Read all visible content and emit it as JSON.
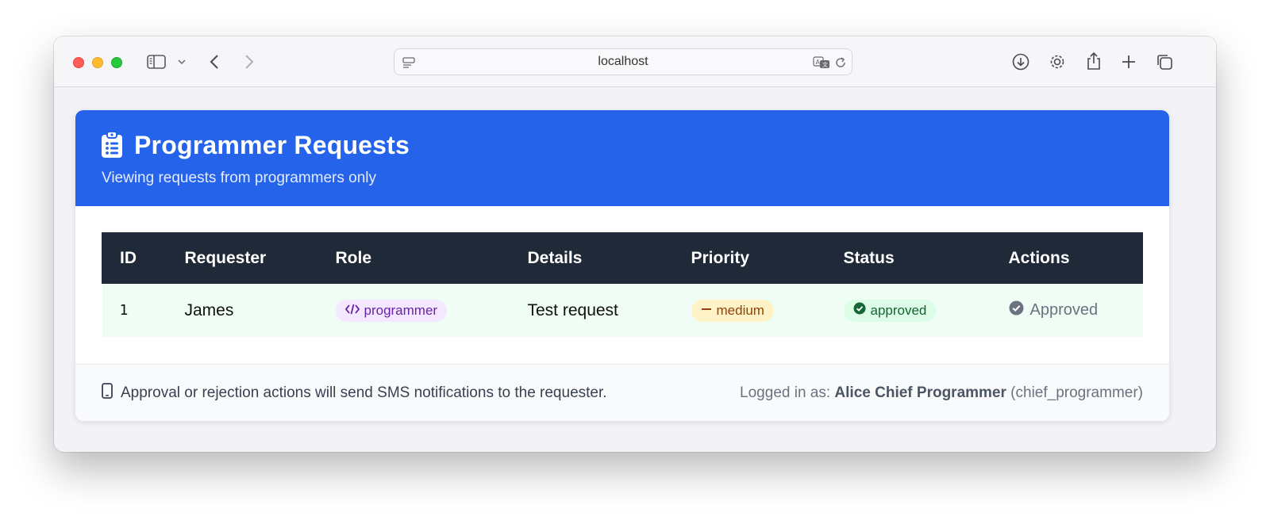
{
  "browser": {
    "url": "localhost"
  },
  "header": {
    "title": "Programmer Requests",
    "subtitle": "Viewing requests from programmers only",
    "color": "#2563eb"
  },
  "table": {
    "columns": [
      "ID",
      "Requester",
      "Role",
      "Details",
      "Priority",
      "Status",
      "Actions"
    ],
    "rows": [
      {
        "id": "1",
        "requester": "James",
        "role": "programmer",
        "details": "Test request",
        "priority": "medium",
        "status": "approved",
        "action": "Approved"
      }
    ]
  },
  "footer": {
    "note": "Approval or rejection actions will send SMS notifications to the requester.",
    "logged_in_prefix": "Logged in as: ",
    "user_name": "Alice Chief Programmer",
    "user_role": " (chief_programmer)"
  },
  "icons": {
    "header": "clipboard-list-icon",
    "role": "code-icon",
    "priority": "minus-icon",
    "status": "check-circle-icon",
    "action": "check-circle-icon",
    "footer": "mobile-phone-icon"
  }
}
